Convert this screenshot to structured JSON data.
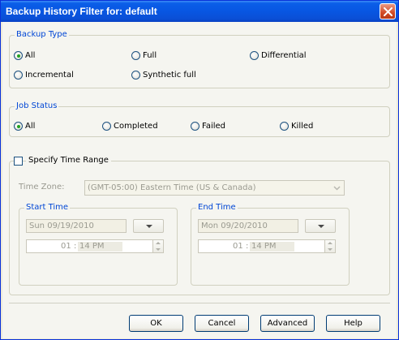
{
  "window": {
    "title": "Backup History Filter for: default"
  },
  "backup_type": {
    "legend": "Backup Type",
    "options": [
      {
        "label": "All",
        "selected": true
      },
      {
        "label": "Full",
        "selected": false
      },
      {
        "label": "Differential",
        "selected": false
      },
      {
        "label": "Incremental",
        "selected": false
      },
      {
        "label": "Synthetic full",
        "selected": false
      }
    ]
  },
  "job_status": {
    "legend": "Job Status",
    "options": [
      {
        "label": "All",
        "selected": true
      },
      {
        "label": "Completed",
        "selected": false
      },
      {
        "label": "Failed",
        "selected": false
      },
      {
        "label": "Killed",
        "selected": false
      }
    ]
  },
  "time_range": {
    "checkbox_label": "Specify Time Range",
    "checked": false,
    "timezone_label": "Time Zone:",
    "timezone_value": "(GMT-05:00) Eastern Time (US & Canada)",
    "start": {
      "legend": "Start Time",
      "date": "Sun 09/19/2010",
      "hour": "01",
      "minute_ampm": "14 PM"
    },
    "end": {
      "legend": "End Time",
      "date": "Mon 09/20/2010",
      "hour": "01",
      "minute_ampm": "14 PM"
    }
  },
  "buttons": {
    "ok": "OK",
    "cancel": "Cancel",
    "advanced": "Advanced",
    "help": "Help"
  },
  "colors": {
    "titlebar": "#0856e2",
    "legend_text": "#0046d5",
    "radio_selected": "#21a121",
    "close_button": "#d24a24"
  }
}
